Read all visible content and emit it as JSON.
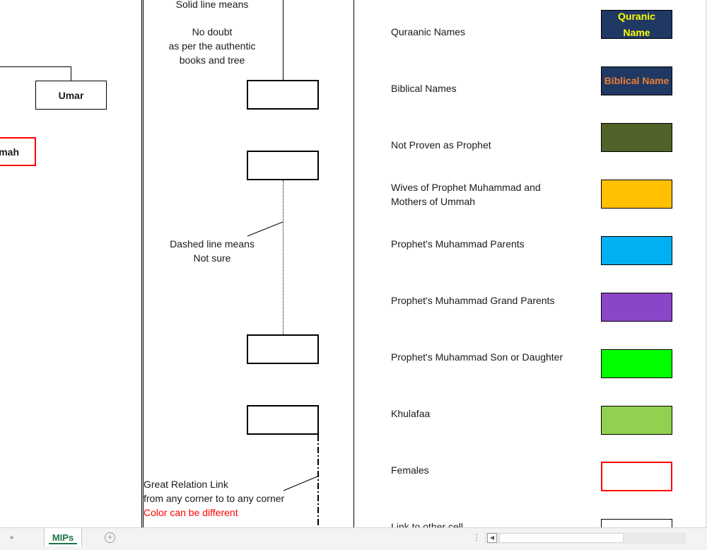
{
  "tree": {
    "umar_label": "Umar",
    "cut_label": "mah"
  },
  "notes": {
    "solid_title": "Solid line means",
    "solid_line1": "No doubt",
    "solid_line2": "as per the authentic",
    "solid_line3": "books and tree",
    "dashed_line1": "Dashed line means",
    "dashed_line2": "Not sure",
    "great_line1": "Great Relation Link",
    "great_line2": "from any corner to to any corner",
    "great_line3": "Color can be different"
  },
  "legend": {
    "items": [
      {
        "label": "Quraanic Names",
        "swatch_text": "Quranic Name",
        "fill": "#1f3864",
        "text_color": "#ffff00",
        "border": "#000000"
      },
      {
        "label": "Biblical Names",
        "swatch_text": "Biblical Name",
        "fill": "#1f3864",
        "text_color": "#ed7d31",
        "border": "#000000"
      },
      {
        "label": "Not Proven as Prophet",
        "fill": "#4f6228",
        "border": "#000000"
      },
      {
        "label_line1": "Wives of Prophet Muhammad and",
        "label_line2": "Mothers of Ummah",
        "fill": "#ffc000",
        "border": "#000000"
      },
      {
        "label": "Prophet's Muhammad Parents",
        "fill": "#00b0f0",
        "border": "#000000"
      },
      {
        "label": "Prophet's Muhammad Grand Parents",
        "fill": "#8b45c9",
        "border": "#000000"
      },
      {
        "label": "Prophet's Muhammad Son or Daughter",
        "fill": "#00ff00",
        "border": "#000000"
      },
      {
        "label": "Khulafaa",
        "fill": "#92d050",
        "border": "#000000"
      },
      {
        "label": "Females",
        "fill": "#ffffff",
        "border": "#ff0000"
      },
      {
        "label": "Link to other cell",
        "fill": "#ffffff",
        "border": "#000000"
      }
    ]
  },
  "tabs": {
    "active": "MIPs",
    "add_icon": "+",
    "dots": "⋮",
    "prev_arrow": "▸",
    "scroll_left": "◀"
  },
  "colors": {
    "female_border": "#ff0000",
    "note_red": "#ff0000",
    "tab_green": "#217346"
  }
}
